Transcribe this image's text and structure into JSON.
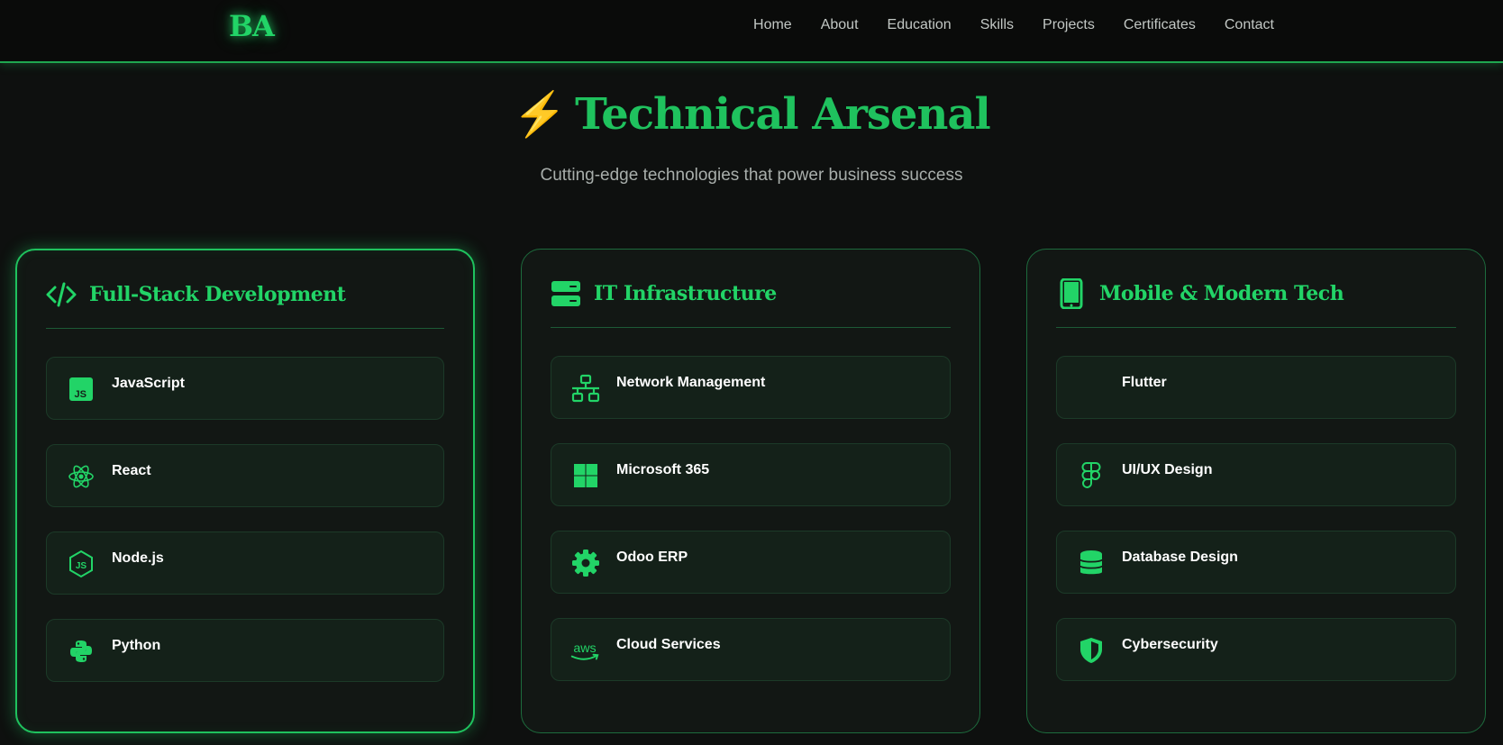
{
  "brand": {
    "logo": "BA",
    "accent_color": "#22d467"
  },
  "nav": {
    "items": [
      "Home",
      "About",
      "Education",
      "Skills",
      "Projects",
      "Certificates",
      "Contact"
    ]
  },
  "hero": {
    "icon": "lightning-bolt-icon",
    "bolt": "⚡",
    "title": "Technical Arsenal",
    "subtitle": "Cutting-edge technologies that power business success"
  },
  "categories": [
    {
      "title": "Full-Stack Development",
      "icon": "code-icon",
      "active": true,
      "skills": [
        {
          "label": "JavaScript",
          "icon": "javascript-icon"
        },
        {
          "label": "React",
          "icon": "react-icon"
        },
        {
          "label": "Node.js",
          "icon": "nodejs-icon"
        },
        {
          "label": "Python",
          "icon": "python-icon"
        }
      ]
    },
    {
      "title": "IT Infrastructure",
      "icon": "server-icon",
      "active": false,
      "skills": [
        {
          "label": "Network Management",
          "icon": "network-icon"
        },
        {
          "label": "Microsoft 365",
          "icon": "microsoft-icon"
        },
        {
          "label": "Odoo ERP",
          "icon": "gear-icon"
        },
        {
          "label": "Cloud Services",
          "icon": "aws-icon"
        }
      ]
    },
    {
      "title": "Mobile & Modern Tech",
      "icon": "mobile-icon",
      "active": false,
      "skills": [
        {
          "label": "Flutter",
          "icon": ""
        },
        {
          "label": "UI/UX Design",
          "icon": "figma-icon"
        },
        {
          "label": "Database Design",
          "icon": "database-icon"
        },
        {
          "label": "Cybersecurity",
          "icon": "shield-icon"
        }
      ]
    }
  ]
}
